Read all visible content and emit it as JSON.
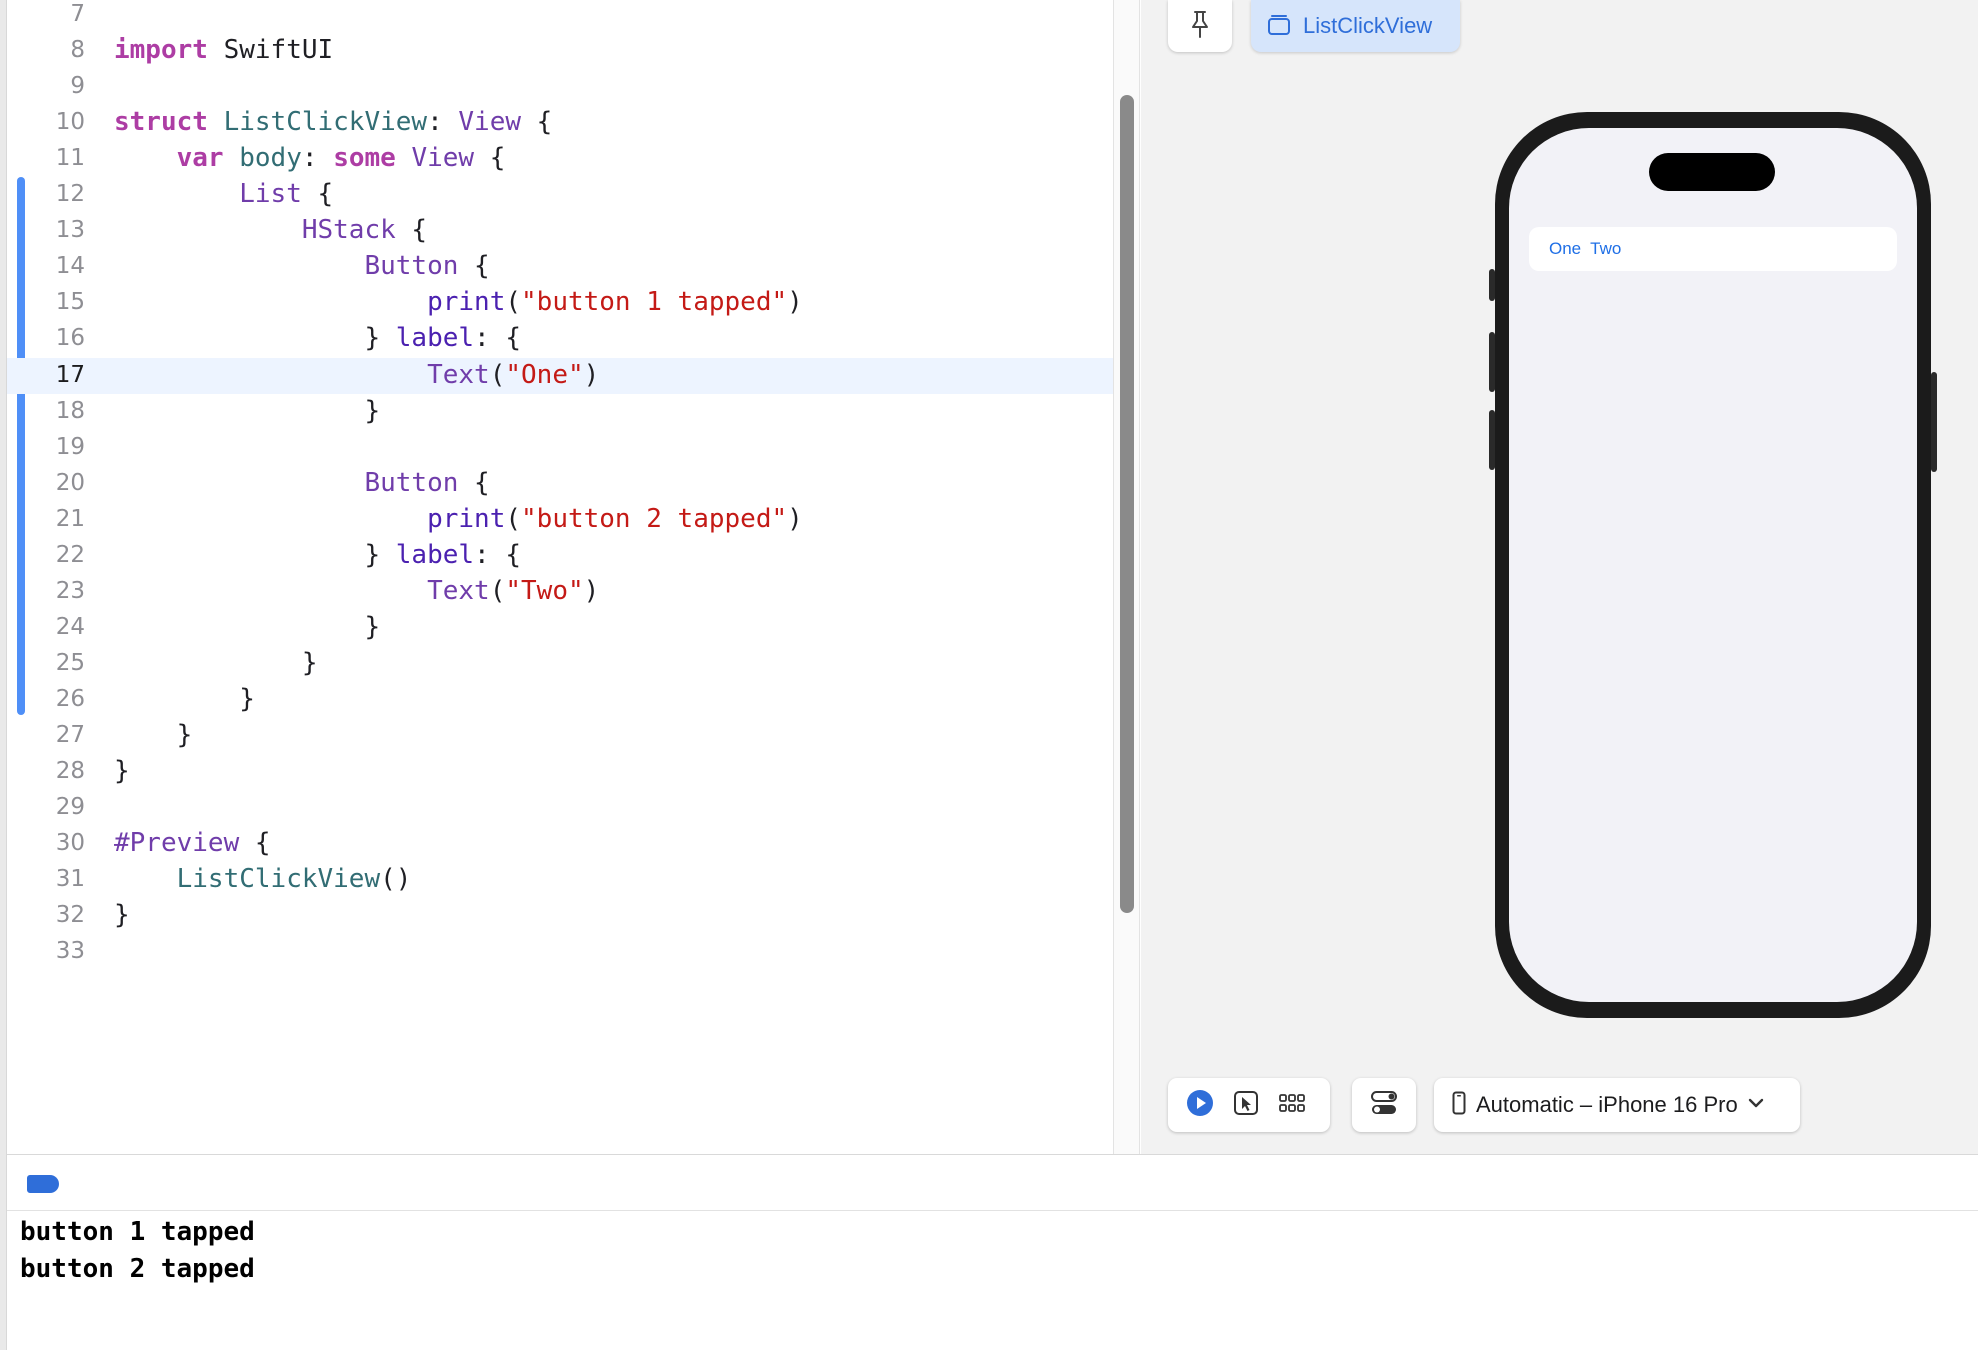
{
  "editor": {
    "current_line": "17",
    "lines": [
      {
        "n": "7",
        "t": [
          [
            "",
            ""
          ]
        ]
      },
      {
        "n": "8",
        "t": [
          [
            "kw",
            "import"
          ],
          [
            "",
            " SwiftUI"
          ]
        ]
      },
      {
        "n": "9",
        "t": [
          [
            "",
            ""
          ]
        ]
      },
      {
        "n": "10",
        "t": [
          [
            "kw",
            "struct"
          ],
          [
            "",
            " "
          ],
          [
            "tn",
            "ListClickView"
          ],
          [
            "",
            ": "
          ],
          [
            "ty",
            "View"
          ],
          [
            "",
            " {"
          ]
        ]
      },
      {
        "n": "11",
        "t": [
          [
            "",
            "    "
          ],
          [
            "kw",
            "var"
          ],
          [
            "",
            " "
          ],
          [
            "tn",
            "body"
          ],
          [
            "",
            ": "
          ],
          [
            "kw",
            "some"
          ],
          [
            "",
            " "
          ],
          [
            "ty",
            "View"
          ],
          [
            "",
            " {"
          ]
        ]
      },
      {
        "n": "12",
        "t": [
          [
            "",
            "        "
          ],
          [
            "ty",
            "List"
          ],
          [
            "",
            " {"
          ]
        ]
      },
      {
        "n": "13",
        "t": [
          [
            "",
            "            "
          ],
          [
            "ty",
            "HStack"
          ],
          [
            "",
            " {"
          ]
        ]
      },
      {
        "n": "14",
        "t": [
          [
            "",
            "                "
          ],
          [
            "ty",
            "Button"
          ],
          [
            "",
            " {"
          ]
        ]
      },
      {
        "n": "15",
        "t": [
          [
            "",
            "                    "
          ],
          [
            "prop",
            "print"
          ],
          [
            "",
            "("
          ],
          [
            "str",
            "\"button 1 tapped\""
          ],
          [
            "",
            ")"
          ]
        ]
      },
      {
        "n": "16",
        "t": [
          [
            "",
            "                } "
          ],
          [
            "prop",
            "label"
          ],
          [
            "",
            ": {"
          ]
        ]
      },
      {
        "n": "17",
        "t": [
          [
            "",
            "                    "
          ],
          [
            "ty",
            "Text"
          ],
          [
            "",
            "("
          ],
          [
            "str",
            "\"One\""
          ],
          [
            "",
            ")"
          ]
        ]
      },
      {
        "n": "18",
        "t": [
          [
            "",
            "                }"
          ]
        ]
      },
      {
        "n": "19",
        "t": [
          [
            "",
            ""
          ]
        ]
      },
      {
        "n": "20",
        "t": [
          [
            "",
            "                "
          ],
          [
            "ty",
            "Button"
          ],
          [
            "",
            " {"
          ]
        ]
      },
      {
        "n": "21",
        "t": [
          [
            "",
            "                    "
          ],
          [
            "prop",
            "print"
          ],
          [
            "",
            "("
          ],
          [
            "str",
            "\"button 2 tapped\""
          ],
          [
            "",
            ")"
          ]
        ]
      },
      {
        "n": "22",
        "t": [
          [
            "",
            "                } "
          ],
          [
            "prop",
            "label"
          ],
          [
            "",
            ": {"
          ]
        ]
      },
      {
        "n": "23",
        "t": [
          [
            "",
            "                    "
          ],
          [
            "ty",
            "Text"
          ],
          [
            "",
            "("
          ],
          [
            "str",
            "\"Two\""
          ],
          [
            "",
            ")"
          ]
        ]
      },
      {
        "n": "24",
        "t": [
          [
            "",
            "                }"
          ]
        ]
      },
      {
        "n": "25",
        "t": [
          [
            "",
            "            }"
          ]
        ]
      },
      {
        "n": "26",
        "t": [
          [
            "",
            "        }"
          ]
        ]
      },
      {
        "n": "27",
        "t": [
          [
            "",
            "    }"
          ]
        ]
      },
      {
        "n": "28",
        "t": [
          [
            "",
            "}"
          ]
        ]
      },
      {
        "n": "29",
        "t": [
          [
            "",
            ""
          ]
        ]
      },
      {
        "n": "30",
        "t": [
          [
            "macro",
            "#Preview"
          ],
          [
            "",
            " {"
          ]
        ]
      },
      {
        "n": "31",
        "t": [
          [
            "",
            "    "
          ],
          [
            "tn",
            "ListClickView"
          ],
          [
            "",
            "()"
          ]
        ]
      },
      {
        "n": "32",
        "t": [
          [
            "",
            "}"
          ]
        ]
      },
      {
        "n": "33",
        "t": [
          [
            "",
            ""
          ]
        ]
      }
    ]
  },
  "canvas": {
    "preview_tab_label": "ListClickView",
    "phone": {
      "buttons": [
        {
          "label": "One"
        },
        {
          "label": "Two"
        }
      ]
    },
    "toolbar": {
      "device_label": "Automatic – iPhone 16 Pro"
    }
  },
  "console": {
    "lines": [
      "button 1 tapped",
      "button 2 tapped"
    ]
  },
  "colors": {
    "accent": "#2f6ed9",
    "keyword": "#ad3da4",
    "string": "#c41a16",
    "type": "#703daa"
  },
  "icons": {
    "pin": "pin-icon",
    "preview": "preview-stack-icon",
    "play": "play-icon",
    "select": "cursor-select-icon",
    "variants": "grid-variants-icon",
    "settings": "toggle-settings-icon",
    "device": "iphone-icon",
    "chevron": "chevron-down-icon"
  }
}
